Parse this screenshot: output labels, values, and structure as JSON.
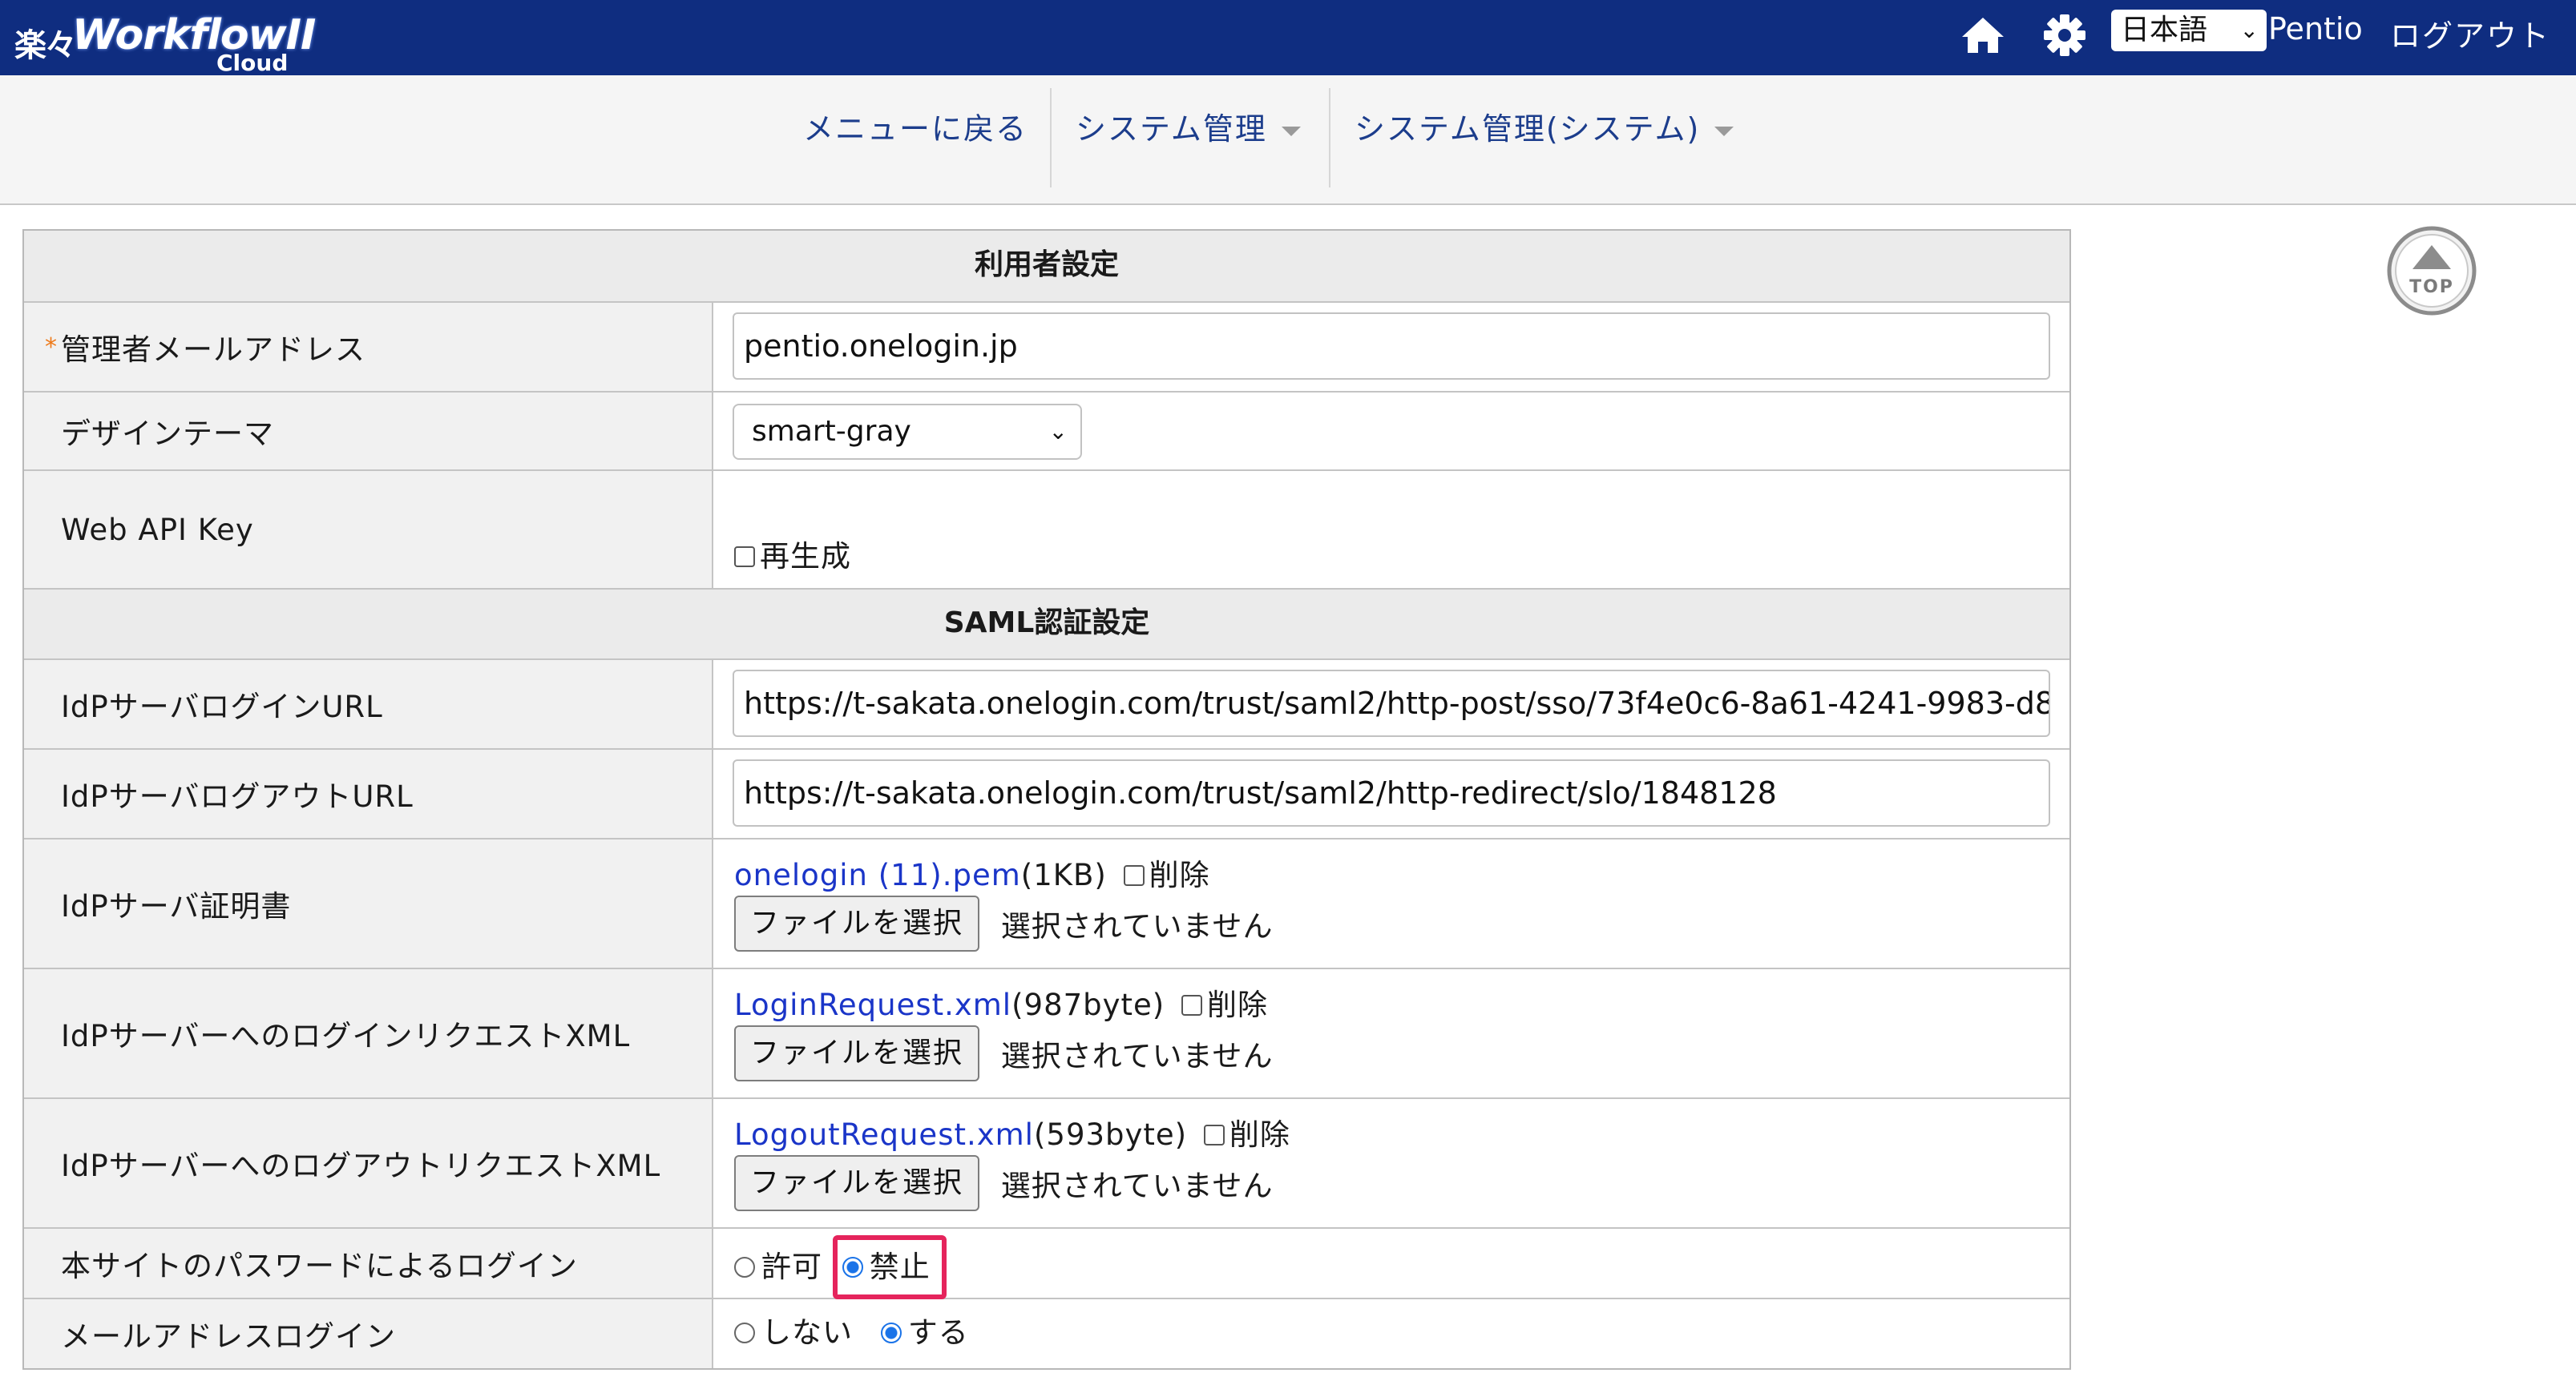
{
  "header": {
    "logo_brand": "楽々",
    "logo_name": "WorkflowII",
    "logo_sub": "Cloud",
    "language": "日本語",
    "user": "Pentio",
    "logout": "ログアウト"
  },
  "nav": {
    "items": [
      {
        "label": "メニューに戻る"
      },
      {
        "label": "システム管理"
      },
      {
        "label": "システム管理(システム)"
      }
    ]
  },
  "top_button": "TOP",
  "form": {
    "section_user": "利用者設定",
    "admin_email": {
      "label": "管理者メールアドレス",
      "required": "*",
      "value": "pentio.onelogin.jp"
    },
    "design_theme": {
      "label": "デザインテーマ",
      "value": "smart-gray"
    },
    "web_api_key": {
      "label": "Web API Key",
      "regen_label": "再生成"
    },
    "section_saml": "SAML認証設定",
    "idp_login_url": {
      "label": "IdPサーバログインURL",
      "value": "https://t-sakata.onelogin.com/trust/saml2/http-post/sso/73f4e0c6-8a61-4241-9983-d8"
    },
    "idp_logout_url": {
      "label": "IdPサーバログアウトURL",
      "value": "https://t-sakata.onelogin.com/trust/saml2/http-redirect/slo/1848128"
    },
    "idp_cert": {
      "label": "IdPサーバ証明書",
      "file": "onelogin (11).pem",
      "size": "(1KB)",
      "delete": "削除",
      "choose": "ファイルを選択",
      "no_file": "選択されていません"
    },
    "login_request": {
      "label": "IdPサーバーへのログインリクエストXML",
      "file": "LoginRequest.xml",
      "size": "(987byte)",
      "delete": "削除",
      "choose": "ファイルを選択",
      "no_file": "選択されていません"
    },
    "logout_request": {
      "label": "IdPサーバーへのログアウトリクエストXML",
      "file": "LogoutRequest.xml",
      "size": "(593byte)",
      "delete": "削除",
      "choose": "ファイルを選択",
      "no_file": "選択されていません"
    },
    "site_password_login": {
      "label": "本サイトのパスワードによるログイン",
      "allow": "許可",
      "deny": "禁止",
      "selected": "禁止"
    },
    "email_login": {
      "label": "メールアドレスログイン",
      "no": "しない",
      "yes": "する",
      "selected": "する"
    }
  },
  "colors": {
    "header_bg": "#0f2d80",
    "link": "#1a35c8",
    "highlight": "#e5245c",
    "required": "#ee7a1a",
    "nav_text": "#1c3d8c"
  }
}
